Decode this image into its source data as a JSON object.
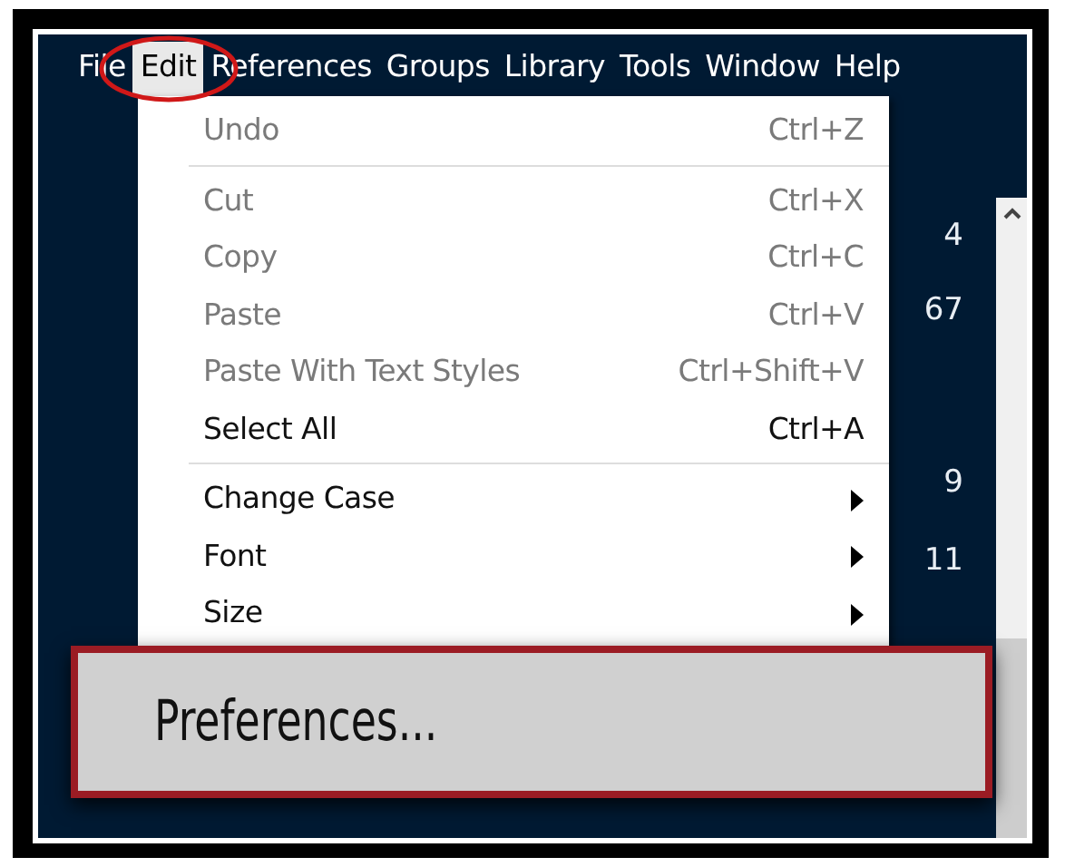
{
  "menubar": [
    {
      "label": "File",
      "selected": false
    },
    {
      "label": "Edit",
      "selected": true
    },
    {
      "label": "References",
      "selected": false
    },
    {
      "label": "Groups",
      "selected": false
    },
    {
      "label": "Library",
      "selected": false
    },
    {
      "label": "Tools",
      "selected": false
    },
    {
      "label": "Window",
      "selected": false
    },
    {
      "label": "Help",
      "selected": false
    }
  ],
  "edit_menu": [
    {
      "kind": "item",
      "label": "Undo",
      "shortcut": "Ctrl+Z",
      "disabled": true
    },
    {
      "kind": "separator"
    },
    {
      "kind": "item",
      "label": "Cut",
      "shortcut": "Ctrl+X",
      "disabled": true
    },
    {
      "kind": "item",
      "label": "Copy",
      "shortcut": "Ctrl+C",
      "disabled": true
    },
    {
      "kind": "item",
      "label": "Paste",
      "shortcut": "Ctrl+V",
      "disabled": true
    },
    {
      "kind": "item",
      "label": "Paste With Text Styles",
      "shortcut": "Ctrl+Shift+V",
      "disabled": true
    },
    {
      "kind": "item",
      "label": "Select All",
      "shortcut": "Ctrl+A",
      "disabled": false
    },
    {
      "kind": "separator"
    },
    {
      "kind": "submenu",
      "label": "Change Case",
      "disabled": false
    },
    {
      "kind": "submenu",
      "label": "Font",
      "disabled": false
    },
    {
      "kind": "submenu",
      "label": "Size",
      "disabled": false
    }
  ],
  "counts": [
    "4",
    "67",
    "9",
    "11"
  ],
  "callout": {
    "label": "Preferences..."
  }
}
